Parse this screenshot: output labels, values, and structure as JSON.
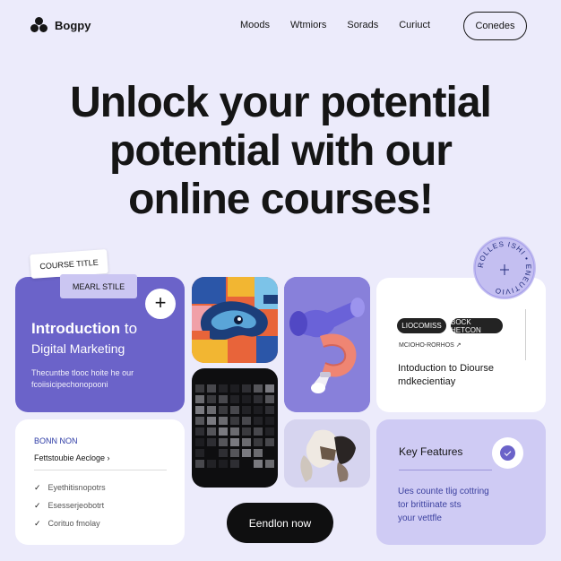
{
  "nav": {
    "brand": "Bogpy",
    "links": [
      "Moods",
      "Wtmiors",
      "Sorads",
      "Curiuct"
    ],
    "cta": "Conedes"
  },
  "hero": {
    "line1": "Unlock your potential",
    "line2": "potential with our",
    "line3": "online courses!"
  },
  "tags": {
    "course_title": "COURSE TITLE",
    "mearl_stile": "MEARL STILE"
  },
  "intro_card": {
    "title_bold": "Introduction",
    "title_rest": " to",
    "subtitle": "Digital Marketing",
    "desc_line1": "Thecuntbe tlooc hoite he our",
    "desc_line2": "fcoiisicipechonopooni",
    "plus": "+"
  },
  "right_card": {
    "pill1": "LIOCOMISS",
    "pill2": "BOCK HETCON",
    "small": "MCIOHO-RORHOS ↗",
    "title_line1": "Intoduction to Diourse",
    "title_line2": "mdkecientiay"
  },
  "bonn_card": {
    "heading": "BONN NON",
    "link": "Fettstoubie Aecloge ›",
    "items": [
      "Eyethitisnopotrs",
      "Esesserjeobotrt",
      "Corituo fmolay"
    ]
  },
  "key_card": {
    "title": "Key Features",
    "desc_line1": "Ues counte tlig cottring",
    "desc_line2": "tor brittiinate sts",
    "desc_line3": "your vettfle"
  },
  "circle_badge_text": "ROLLES ISHI • ENEUTIVIO",
  "enroll_button": "Eendlon now",
  "colors": {
    "background": "#ecebfb",
    "accent": "#6b63c9",
    "dark": "#0f0f10",
    "light_purple": "#cfcbf4"
  }
}
